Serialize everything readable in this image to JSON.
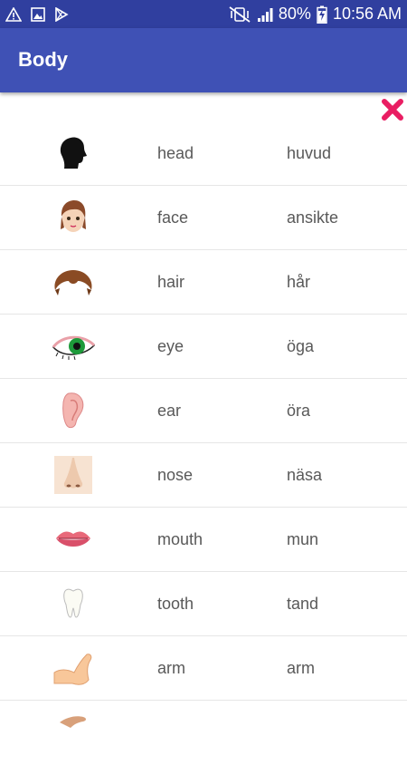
{
  "status_bar": {
    "battery": "80%",
    "time": "10:56 AM",
    "icons": [
      "warning-icon",
      "image-icon",
      "play-store-icon",
      "vibrate-mute-icon",
      "signal-icon",
      "battery-charging-icon"
    ]
  },
  "app_bar": {
    "title": "Body",
    "color": "#3f51b5",
    "status_color": "#303f9f"
  },
  "close_button": {
    "icon": "close-icon",
    "color": "#e91e63"
  },
  "words": [
    {
      "english": "head",
      "swedish": "huvud",
      "icon": "head-silhouette-icon"
    },
    {
      "english": "face",
      "swedish": "ansikte",
      "icon": "face-icon"
    },
    {
      "english": "hair",
      "swedish": "hår",
      "icon": "hair-icon"
    },
    {
      "english": "eye",
      "swedish": "öga",
      "icon": "eye-icon"
    },
    {
      "english": "ear",
      "swedish": "öra",
      "icon": "ear-icon"
    },
    {
      "english": "nose",
      "swedish": "näsa",
      "icon": "nose-icon"
    },
    {
      "english": "mouth",
      "swedish": "mun",
      "icon": "mouth-icon"
    },
    {
      "english": "tooth",
      "swedish": "tand",
      "icon": "tooth-icon"
    },
    {
      "english": "arm",
      "swedish": "arm",
      "icon": "arm-icon"
    },
    {
      "english": "",
      "swedish": "",
      "icon": "hand-icon"
    }
  ]
}
